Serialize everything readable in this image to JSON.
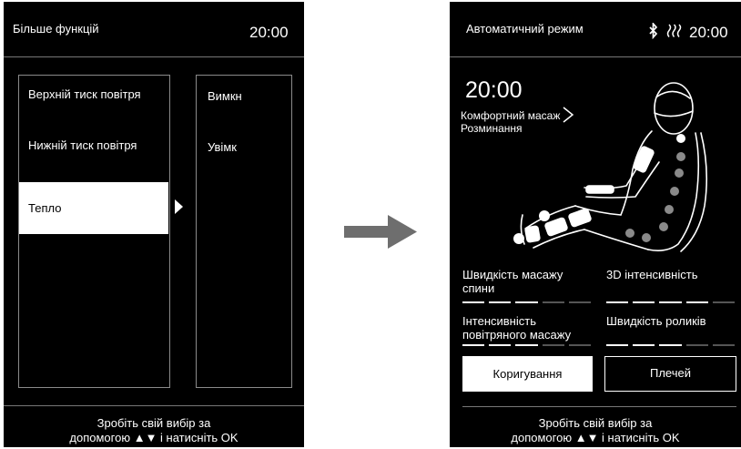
{
  "left_screen": {
    "title": "Більше функцій",
    "time": "20:00",
    "options": [
      {
        "label": "Верхній тиск повітря",
        "selected": false
      },
      {
        "label": "Нижній тиск повітря",
        "selected": false
      },
      {
        "label": "Тепло",
        "selected": true
      }
    ],
    "values": [
      "Вимкн",
      "Увімк"
    ],
    "footer_line1": "Зробіть свій вибір за",
    "footer_line2": "допомогою ▲▼ і натисніть OK"
  },
  "right_screen": {
    "title": "Автоматичний режим",
    "status_icons": [
      "bluetooth-icon",
      "heat-icon"
    ],
    "time": "20:00",
    "big_time": "20:00",
    "mode_line1": "Комфортний масаж",
    "mode_line2": "Розминання",
    "chevron": ">",
    "settings": [
      {
        "label_line1": "Швидкість масажу",
        "label_line2": "спини",
        "level": 3,
        "max": 5
      },
      {
        "label_line1": "3D  інтенсивність",
        "label_line2": "",
        "level": 4,
        "max": 5
      },
      {
        "label_line1": "Інтенсивність",
        "label_line2": "повітряного масажу",
        "level": 3,
        "max": 5
      },
      {
        "label_line1": "Швидкість роликів",
        "label_line2": "",
        "level": 3,
        "max": 5
      }
    ],
    "buttons": [
      {
        "label": "Коригування",
        "style": "filled"
      },
      {
        "label": "Плечей",
        "style": "outline"
      }
    ],
    "footer_line1": "Зробіть свій вибір за",
    "footer_line2": "допомогою ▲▼ і натисніть OK"
  },
  "colors": {
    "screen_bg": "#000000",
    "text": "#ffffff",
    "divider": "#777777",
    "panel_border": "#8a8a8a",
    "arrow": "#6e6e6e",
    "inactive_bar": "#555555",
    "dot": "#8a8a8a"
  }
}
